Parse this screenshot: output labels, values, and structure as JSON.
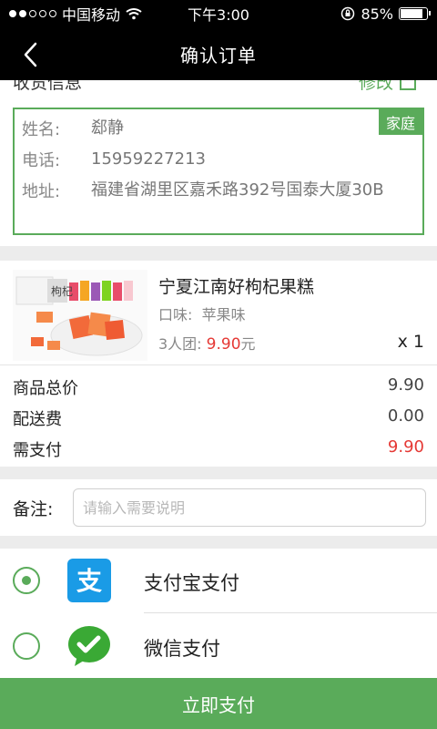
{
  "status_bar": {
    "carrier": "中国移动",
    "time": "下午3:00",
    "battery": "85%"
  },
  "nav": {
    "title": "确认订单"
  },
  "address": {
    "section_title": "收货信息",
    "edit_label": "修改",
    "tag": "家庭",
    "name_label": "姓名:",
    "name": "郄静",
    "phone_label": "电话:",
    "phone": "15959227213",
    "address_label": "地址:",
    "address": "福建省湖里区嘉禾路392号国泰大厦30B"
  },
  "product": {
    "name": "宁夏江南好枸杞果糕",
    "flavor_label": "口味:",
    "flavor": "苹果味",
    "group_label": "3人团:",
    "group_price": "9.90",
    "price_unit": "元",
    "quantity": "x 1",
    "thumbnail_text": "枸杞"
  },
  "summary": {
    "total_label": "商品总价",
    "total": "9.90",
    "shipping_label": "配送费",
    "shipping": "0.00",
    "payable_label": "需支付",
    "payable": "9.90"
  },
  "note": {
    "label": "备注:",
    "placeholder": "请输入需要说明"
  },
  "payment": {
    "alipay_label": "支付宝支付",
    "alipay_icon_char": "支",
    "wechat_label": "微信支付",
    "selected": "alipay"
  },
  "action": {
    "pay_button": "立即支付"
  },
  "colors": {
    "accent": "#5aab5a",
    "price_red": "#e53935",
    "alipay_blue": "#1a9be6",
    "wechat_green": "#3aa935"
  },
  "icons": {
    "back": "chevron-left-icon",
    "edit": "edit-icon",
    "alipay": "alipay-icon",
    "wechat": "wechat-pay-icon"
  }
}
